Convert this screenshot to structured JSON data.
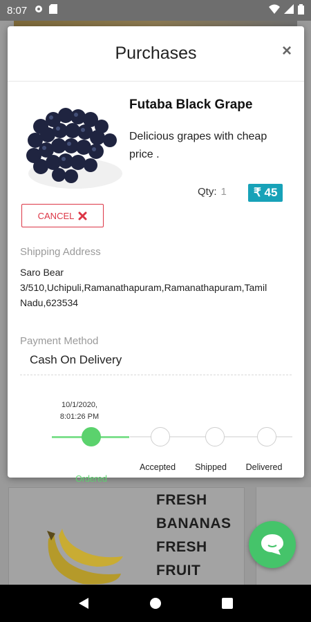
{
  "status_bar": {
    "time": "8:07"
  },
  "background": {
    "card_text_lines": [
      "FRESH",
      "BANANAS",
      "FRESH",
      "FRUIT"
    ]
  },
  "modal": {
    "title": "Purchases",
    "close_label": "×",
    "product": {
      "name": "Futaba Black Grape",
      "description": "Delicious grapes with cheap price .",
      "qty_label": "Qty:",
      "qty_value": "1",
      "price": "₹ 45"
    },
    "cancel_label": "CANCEL",
    "shipping": {
      "label": "Shipping Address",
      "name": "Saro Bear",
      "address": "3/510,Uchipuli,Ramanathapuram,Ramanathapuram,Tamil Nadu,623534"
    },
    "payment": {
      "label": "Payment Method",
      "value": "Cash On Delivery"
    },
    "tracker": {
      "date_line1": "10/1/2020,",
      "date_line2": "8:01:26 PM",
      "steps": [
        {
          "label": "Ordered",
          "done": true
        },
        {
          "label": "Accepted",
          "done": false
        },
        {
          "label": "Shipped",
          "done": false
        },
        {
          "label": "Delivered",
          "done": false
        }
      ]
    }
  },
  "colors": {
    "accent_green": "#5bd26d",
    "price_badge": "#17a2b8",
    "cancel_red": "#dc3545",
    "chat_fab": "#45c46a"
  }
}
